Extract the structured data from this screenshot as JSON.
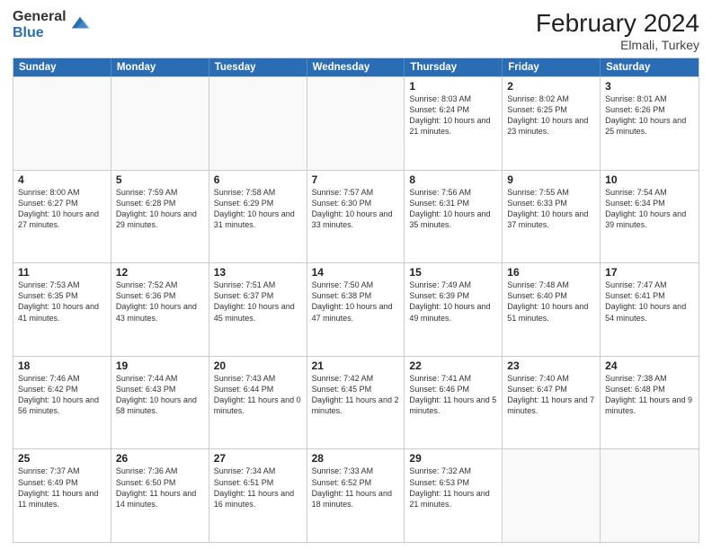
{
  "logo": {
    "general": "General",
    "blue": "Blue"
  },
  "title": {
    "month_year": "February 2024",
    "location": "Elmali, Turkey"
  },
  "header_days": [
    "Sunday",
    "Monday",
    "Tuesday",
    "Wednesday",
    "Thursday",
    "Friday",
    "Saturday"
  ],
  "weeks": [
    [
      {
        "day": "",
        "info": ""
      },
      {
        "day": "",
        "info": ""
      },
      {
        "day": "",
        "info": ""
      },
      {
        "day": "",
        "info": ""
      },
      {
        "day": "1",
        "info": "Sunrise: 8:03 AM\nSunset: 6:24 PM\nDaylight: 10 hours and 21 minutes."
      },
      {
        "day": "2",
        "info": "Sunrise: 8:02 AM\nSunset: 6:25 PM\nDaylight: 10 hours and 23 minutes."
      },
      {
        "day": "3",
        "info": "Sunrise: 8:01 AM\nSunset: 6:26 PM\nDaylight: 10 hours and 25 minutes."
      }
    ],
    [
      {
        "day": "4",
        "info": "Sunrise: 8:00 AM\nSunset: 6:27 PM\nDaylight: 10 hours and 27 minutes."
      },
      {
        "day": "5",
        "info": "Sunrise: 7:59 AM\nSunset: 6:28 PM\nDaylight: 10 hours and 29 minutes."
      },
      {
        "day": "6",
        "info": "Sunrise: 7:58 AM\nSunset: 6:29 PM\nDaylight: 10 hours and 31 minutes."
      },
      {
        "day": "7",
        "info": "Sunrise: 7:57 AM\nSunset: 6:30 PM\nDaylight: 10 hours and 33 minutes."
      },
      {
        "day": "8",
        "info": "Sunrise: 7:56 AM\nSunset: 6:31 PM\nDaylight: 10 hours and 35 minutes."
      },
      {
        "day": "9",
        "info": "Sunrise: 7:55 AM\nSunset: 6:33 PM\nDaylight: 10 hours and 37 minutes."
      },
      {
        "day": "10",
        "info": "Sunrise: 7:54 AM\nSunset: 6:34 PM\nDaylight: 10 hours and 39 minutes."
      }
    ],
    [
      {
        "day": "11",
        "info": "Sunrise: 7:53 AM\nSunset: 6:35 PM\nDaylight: 10 hours and 41 minutes."
      },
      {
        "day": "12",
        "info": "Sunrise: 7:52 AM\nSunset: 6:36 PM\nDaylight: 10 hours and 43 minutes."
      },
      {
        "day": "13",
        "info": "Sunrise: 7:51 AM\nSunset: 6:37 PM\nDaylight: 10 hours and 45 minutes."
      },
      {
        "day": "14",
        "info": "Sunrise: 7:50 AM\nSunset: 6:38 PM\nDaylight: 10 hours and 47 minutes."
      },
      {
        "day": "15",
        "info": "Sunrise: 7:49 AM\nSunset: 6:39 PM\nDaylight: 10 hours and 49 minutes."
      },
      {
        "day": "16",
        "info": "Sunrise: 7:48 AM\nSunset: 6:40 PM\nDaylight: 10 hours and 51 minutes."
      },
      {
        "day": "17",
        "info": "Sunrise: 7:47 AM\nSunset: 6:41 PM\nDaylight: 10 hours and 54 minutes."
      }
    ],
    [
      {
        "day": "18",
        "info": "Sunrise: 7:46 AM\nSunset: 6:42 PM\nDaylight: 10 hours and 56 minutes."
      },
      {
        "day": "19",
        "info": "Sunrise: 7:44 AM\nSunset: 6:43 PM\nDaylight: 10 hours and 58 minutes."
      },
      {
        "day": "20",
        "info": "Sunrise: 7:43 AM\nSunset: 6:44 PM\nDaylight: 11 hours and 0 minutes."
      },
      {
        "day": "21",
        "info": "Sunrise: 7:42 AM\nSunset: 6:45 PM\nDaylight: 11 hours and 2 minutes."
      },
      {
        "day": "22",
        "info": "Sunrise: 7:41 AM\nSunset: 6:46 PM\nDaylight: 11 hours and 5 minutes."
      },
      {
        "day": "23",
        "info": "Sunrise: 7:40 AM\nSunset: 6:47 PM\nDaylight: 11 hours and 7 minutes."
      },
      {
        "day": "24",
        "info": "Sunrise: 7:38 AM\nSunset: 6:48 PM\nDaylight: 11 hours and 9 minutes."
      }
    ],
    [
      {
        "day": "25",
        "info": "Sunrise: 7:37 AM\nSunset: 6:49 PM\nDaylight: 11 hours and 11 minutes."
      },
      {
        "day": "26",
        "info": "Sunrise: 7:36 AM\nSunset: 6:50 PM\nDaylight: 11 hours and 14 minutes."
      },
      {
        "day": "27",
        "info": "Sunrise: 7:34 AM\nSunset: 6:51 PM\nDaylight: 11 hours and 16 minutes."
      },
      {
        "day": "28",
        "info": "Sunrise: 7:33 AM\nSunset: 6:52 PM\nDaylight: 11 hours and 18 minutes."
      },
      {
        "day": "29",
        "info": "Sunrise: 7:32 AM\nSunset: 6:53 PM\nDaylight: 11 hours and 21 minutes."
      },
      {
        "day": "",
        "info": ""
      },
      {
        "day": "",
        "info": ""
      }
    ]
  ]
}
